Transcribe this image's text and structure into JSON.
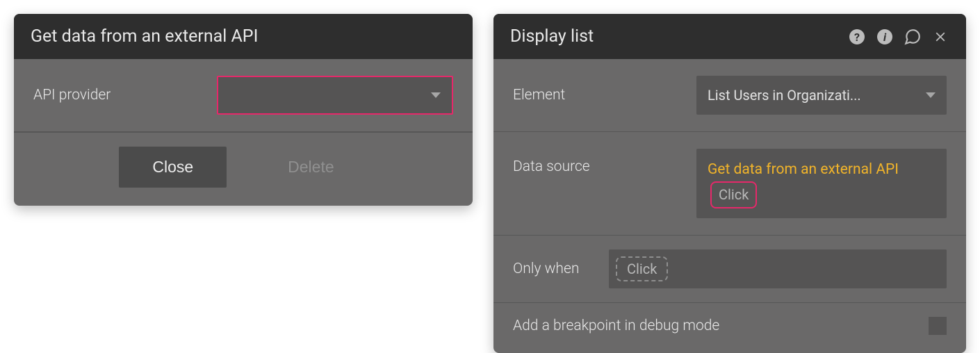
{
  "left_panel": {
    "title": "Get data from an external API",
    "api_provider_label": "API provider",
    "api_provider_value": "",
    "close_label": "Close",
    "delete_label": "Delete"
  },
  "right_panel": {
    "title": "Display list",
    "element_label": "Element",
    "element_value": "List Users in Organizati...",
    "data_source_label": "Data source",
    "data_source_expression": "Get data from an external API",
    "data_source_click": "Click",
    "only_when_label": "Only when",
    "only_when_click": "Click",
    "breakpoint_label": "Add a breakpoint in debug mode"
  }
}
